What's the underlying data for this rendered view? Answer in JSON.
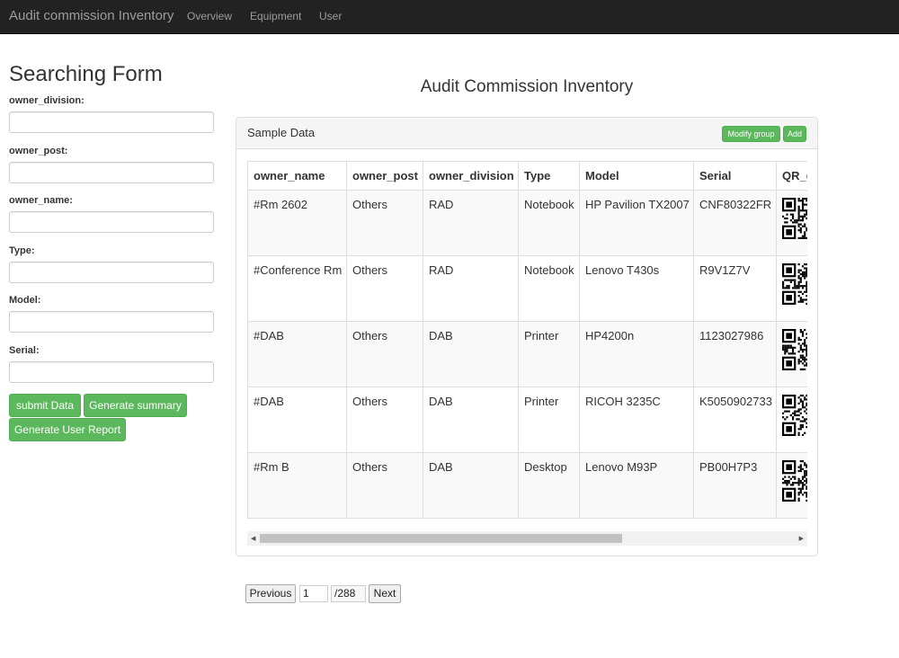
{
  "navbar": {
    "brand": "Audit commission Inventory",
    "links": [
      "Overview",
      "Equipment",
      "User"
    ]
  },
  "form": {
    "title": "Searching Form",
    "fields": [
      {
        "label": "owner_division:",
        "value": ""
      },
      {
        "label": "owner_post:",
        "value": ""
      },
      {
        "label": "owner_name:",
        "value": ""
      },
      {
        "label": "Type:",
        "value": ""
      },
      {
        "label": "Model:",
        "value": ""
      },
      {
        "label": "Serial:",
        "value": ""
      }
    ],
    "buttons": {
      "submit": "submit Data",
      "summary": "Generate summary",
      "user_report": "Generate User Report"
    }
  },
  "main": {
    "title": "Audit Commission Inventory",
    "panel": {
      "title": "Sample Data",
      "modify_group": "Modify group",
      "add": "Add"
    },
    "table": {
      "columns": [
        "owner_name",
        "owner_post",
        "owner_division",
        "Type",
        "Model",
        "Serial",
        "QR_c"
      ],
      "rows": [
        [
          "#Rm 2602",
          "Others",
          "RAD",
          "Notebook",
          "HP Pavilion TX2007",
          "CNF80322FR"
        ],
        [
          "#Conference Rm",
          "Others",
          "RAD",
          "Notebook",
          "Lenovo T430s",
          "R9V1Z7V"
        ],
        [
          "#DAB",
          "Others",
          "DAB",
          "Printer",
          "HP4200n",
          "1123027986"
        ],
        [
          "#DAB",
          "Others",
          "DAB",
          "Printer",
          "RICOH 3235C",
          "K5050902733"
        ],
        [
          "#Rm B",
          "Others",
          "DAB",
          "Desktop",
          "Lenovo M93P",
          "PB00H7P3"
        ]
      ]
    }
  },
  "pagination": {
    "previous": "Previous",
    "page": "1",
    "total": "/288",
    "next": "Next"
  },
  "colors": {
    "navbar_bg": "#222222",
    "button_green": "#5cb85c"
  }
}
